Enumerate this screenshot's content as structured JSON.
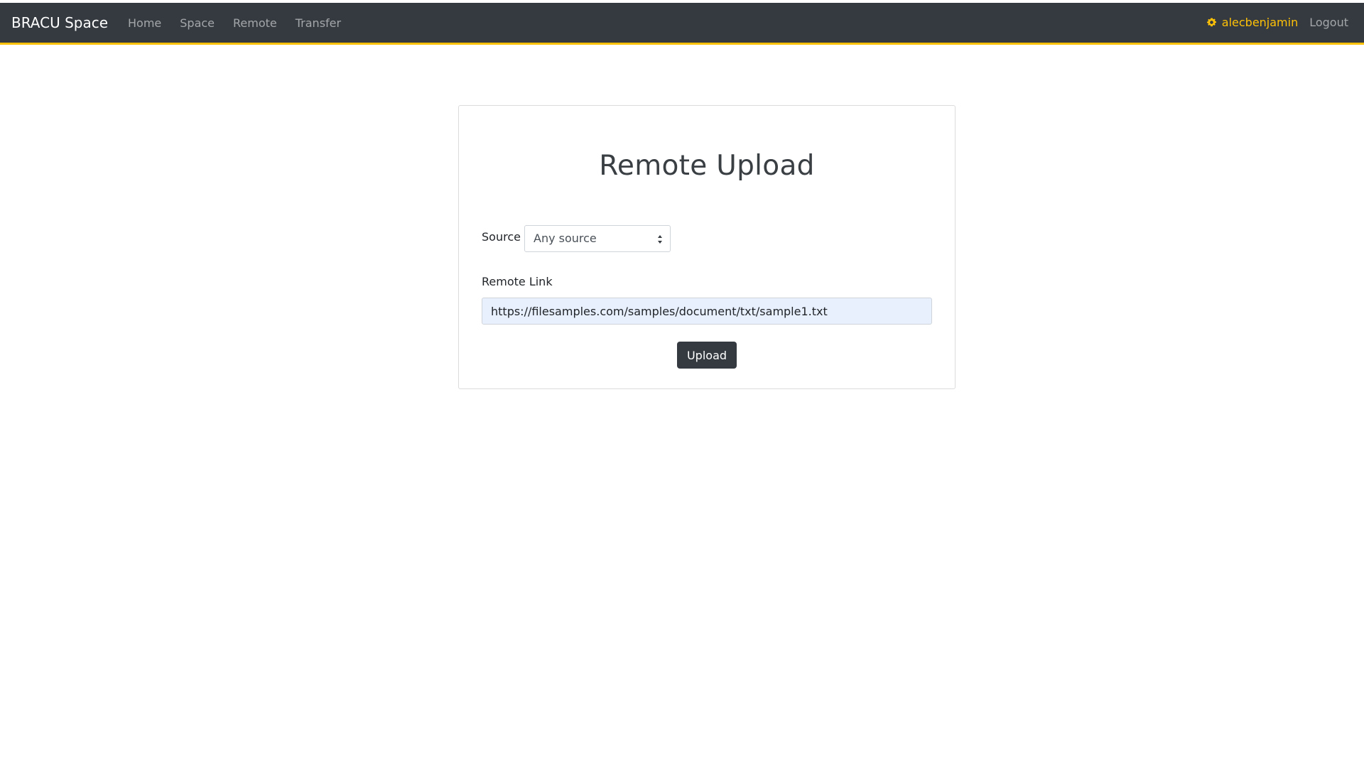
{
  "navbar": {
    "brand": "BRACU Space",
    "links": [
      "Home",
      "Space",
      "Remote",
      "Transfer"
    ],
    "user": "alecbenjamin",
    "logout": "Logout",
    "accent_color": "#ffc107",
    "background_color": "#343a40"
  },
  "page": {
    "title": "Remote Upload",
    "source_label": "Source",
    "source_selected": "Any source",
    "remote_link_label": "Remote Link",
    "remote_link_value": "https://filesamples.com/samples/document/txt/sample1.txt",
    "upload_label": "Upload"
  },
  "icons": {
    "user": "gear-icon",
    "select": "sort-arrows-icon"
  }
}
